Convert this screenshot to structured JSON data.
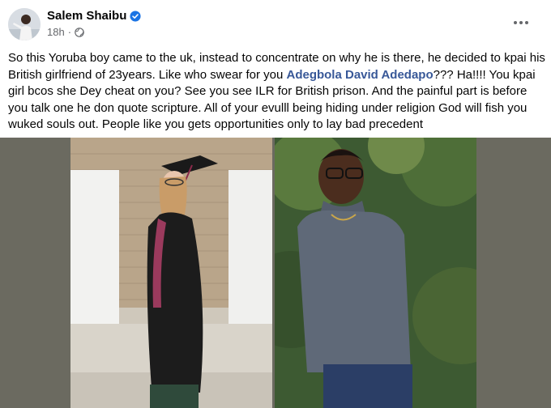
{
  "post": {
    "author": "Salem Shaibu",
    "verified_icon": "verified-badge-icon",
    "time": "18h",
    "separator": "·",
    "privacy_icon": "globe-icon",
    "more_icon": "more-options-icon",
    "text_before": "So this Yoruba boy came to the uk, instead to concentrate on why he is there, he decided to kpai his British girlfriend of 23years. Like who swear for you ",
    "mention": "Adegbola David Adedapo",
    "text_after": "??? Ha!!!! You kpai girl bcos she Dey cheat on you? See you see ILR for British prison.  And the painful part is before you talk one he don quote scripture.  All of your evulll being hiding under religion God will fish you wuked souls out. People like you gets opportunities only to lay bad precedent"
  },
  "colors": {
    "text": "#050505",
    "secondary": "#65676b",
    "mention": "#385898",
    "verified": "#1b74e4",
    "media_bg": "#6b6a60"
  }
}
